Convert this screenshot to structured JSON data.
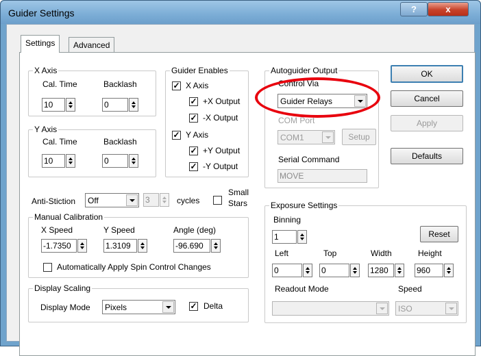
{
  "window": {
    "title": "Guider Settings",
    "help_glyph": "?",
    "close_glyph": "x"
  },
  "tabs": [
    {
      "label": "Settings"
    },
    {
      "label": "Advanced"
    }
  ],
  "x_axis": {
    "label": "X Axis",
    "cal_time_label": "Cal. Time",
    "backlash_label": "Backlash",
    "cal_time": "10",
    "backlash": "0"
  },
  "y_axis": {
    "label": "Y Axis",
    "cal_time_label": "Cal. Time",
    "backlash_label": "Backlash",
    "cal_time": "10",
    "backlash": "0"
  },
  "guider_enables": {
    "label": "Guider Enables",
    "x_axis": "X Axis",
    "plus_x": "+X Output",
    "minus_x": "-X Output",
    "y_axis": "Y Axis",
    "plus_y": "+Y Output",
    "minus_y": "-Y Output",
    "check": "✓"
  },
  "autoguider_output": {
    "label": "Autoguider Output",
    "control_via_label": "Control Via",
    "control_via": "Guider Relays",
    "com_port_label": "COM Port",
    "com_port": "COM1",
    "setup_label": "Setup",
    "serial_command_label": "Serial Command",
    "serial_command": "MOVE"
  },
  "buttons": {
    "ok": "OK",
    "cancel": "Cancel",
    "apply": "Apply",
    "defaults": "Defaults"
  },
  "anti_stiction": {
    "label": "Anti-Stiction",
    "value": "Off",
    "cycles": "3",
    "cycles_label": "cycles",
    "small_stars_line1": "Small",
    "small_stars_line2": "Stars"
  },
  "manual_calibration": {
    "label": "Manual Calibration",
    "x_speed_label": "X Speed",
    "y_speed_label": "Y Speed",
    "angle_label": "Angle (deg)",
    "x_speed": "-1.7350",
    "y_speed": "1.3109",
    "angle": "-96.690",
    "auto_apply_label": "Automatically Apply Spin Control Changes"
  },
  "display_scaling": {
    "label": "Display Scaling",
    "mode_label": "Display Mode",
    "mode": "Pixels",
    "delta_label": "Delta"
  },
  "exposure": {
    "label": "Exposure Settings",
    "binning_label": "Binning",
    "binning": "1",
    "reset_label": "Reset",
    "left_label": "Left",
    "top_label": "Top",
    "width_label": "Width",
    "height_label": "Height",
    "left": "0",
    "top": "0",
    "width": "1280",
    "height": "960",
    "readout_label": "Readout Mode",
    "readout": "",
    "speed_label": "Speed",
    "speed": "ISO"
  },
  "colors": {
    "highlight": "#e8000d",
    "title_bar": "#7cadd6"
  }
}
